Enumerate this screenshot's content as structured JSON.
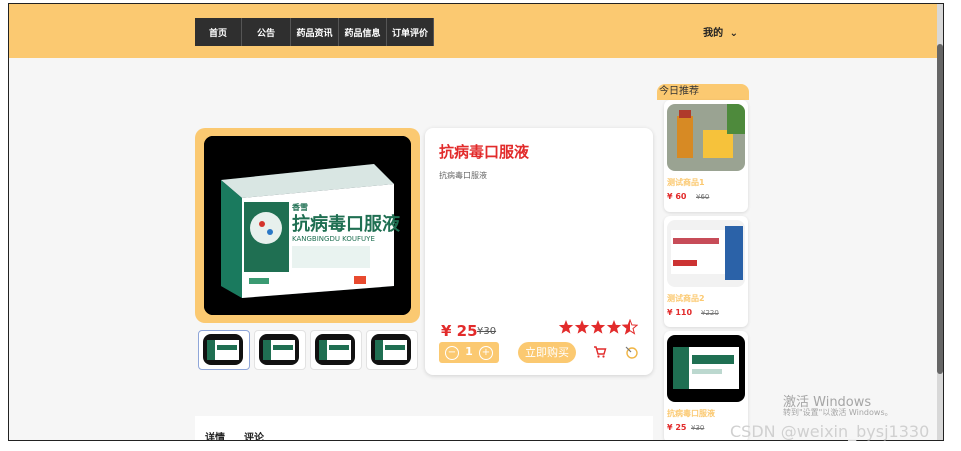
{
  "nav": {
    "items": [
      "首页",
      "公告",
      "药品资讯",
      "药品信息",
      "订单评价"
    ]
  },
  "user": {
    "label": "我的",
    "caret": "⌄"
  },
  "product": {
    "name": "抗病毒口服液",
    "description": "抗病毒口服液",
    "price": "¥ 25",
    "old_price": "¥30",
    "rating": 4.5,
    "quantity": "1",
    "buy_label": "立即购买",
    "box_brand": "香雪",
    "box_title": "抗病毒口服液",
    "box_pinyin": "KANGBINGDU KOUFUYE"
  },
  "recommend": {
    "title": "今日推荐",
    "items": [
      {
        "name": "测试商品1",
        "price": "¥ 60",
        "old_price": "¥60"
      },
      {
        "name": "测试商品2",
        "price": "¥ 110",
        "old_price": "¥220"
      },
      {
        "name": "抗病毒口服液",
        "price": "¥ 25",
        "old_price": "¥30"
      }
    ]
  },
  "tabs": [
    "详情",
    "评论"
  ],
  "overlays": {
    "activate_windows": "激活 Windows",
    "activate_hint": "转到\"设置\"以激活 Windows。",
    "csdn": "CSDN @weixin_bysj1330"
  },
  "colors": {
    "accent": "#fbc971",
    "price": "#e22b2b",
    "nav_bg": "#2f2f2f"
  },
  "icons": [
    "minus-icon",
    "plus-icon",
    "cart-icon",
    "collect-icon",
    "star-icon"
  ]
}
